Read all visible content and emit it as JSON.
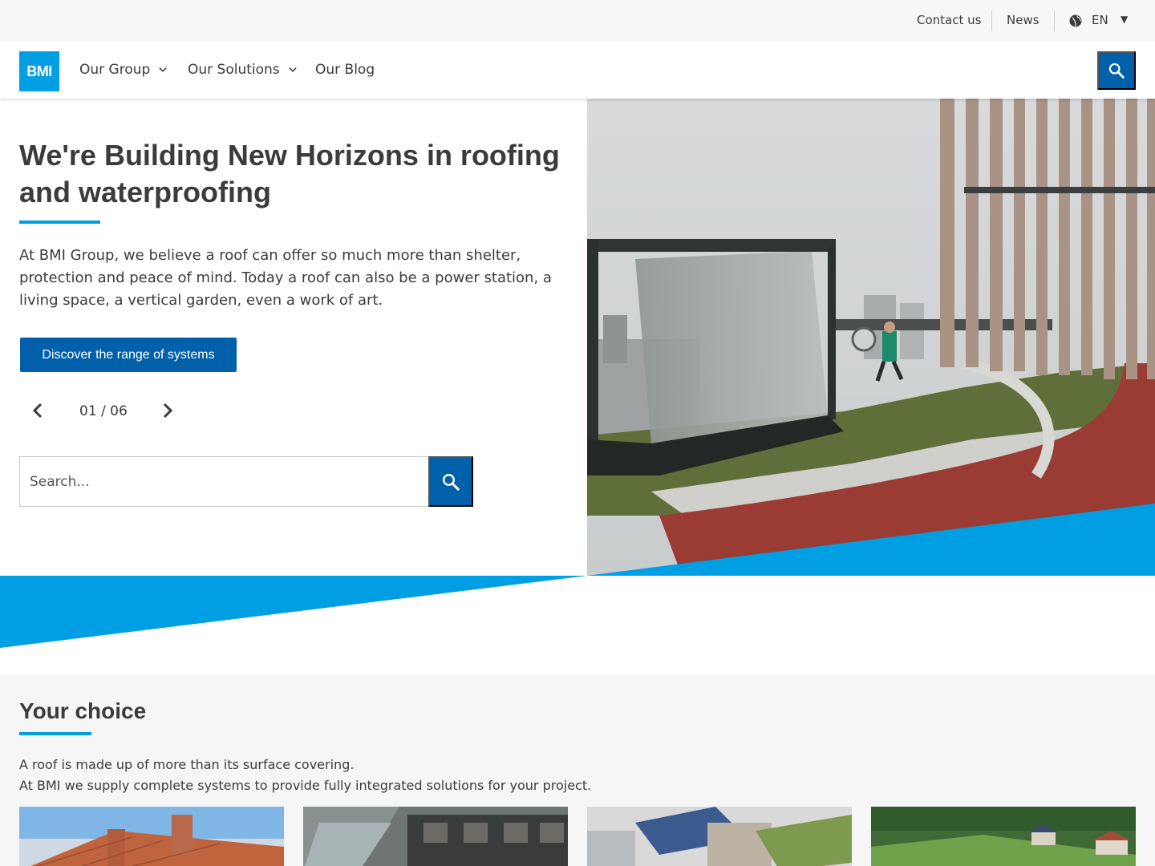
{
  "utility_bar": {
    "contact": "Contact us",
    "news": "News",
    "language": "EN",
    "icons": {
      "language": "globe-icon",
      "language_caret": "caret-down-icon"
    }
  },
  "header": {
    "logo": "BMI",
    "nav": [
      {
        "label": "Our Group",
        "has_dropdown": true
      },
      {
        "label": "Our Solutions",
        "has_dropdown": true
      },
      {
        "label": "Our Blog",
        "has_dropdown": false
      }
    ],
    "icons": {
      "search": "search-icon",
      "dropdown": "chevron-down-icon"
    }
  },
  "hero": {
    "title": "We're Building New Horizons in roofing and waterproofing",
    "text": "At BMI Group, we believe a roof can offer so much more than shelter, protection and peace of mind. Today a roof can also be a power station, a living space, a vertical garden, even a work of art.",
    "cta": "Discover the range of systems",
    "pager": "01 / 06",
    "search_placeholder": "Search..."
  },
  "choice": {
    "title": "Your choice",
    "line1": "A roof is made up of more than its surface covering.",
    "line2": "At BMI we supply complete systems to provide fully integrated solutions for your project."
  },
  "colors": {
    "brand_blue": "#009fe3",
    "button_blue": "#0060a9",
    "text": "#3b3b3b",
    "utility_bg": "#f7f7f7",
    "section_bg": "#f6f6f6"
  }
}
